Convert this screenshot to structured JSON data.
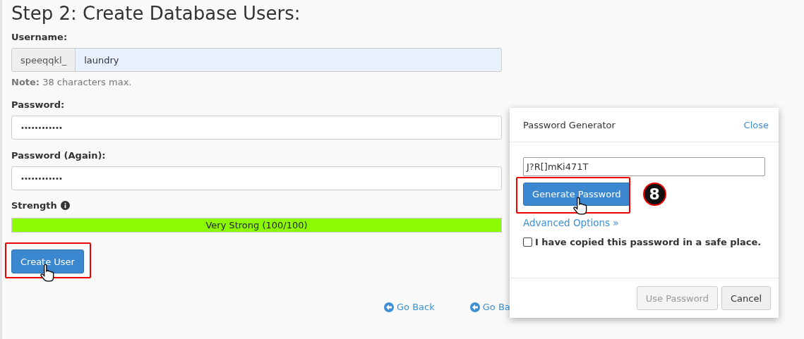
{
  "heading": "Step 2: Create Database Users:",
  "username": {
    "label": "Username:",
    "prefix": "speeqqkl_",
    "value": "laundry",
    "note_bold": "Note:",
    "note": "38 characters max."
  },
  "password": {
    "label": "Password:",
    "value": "••••••••••••"
  },
  "password_again": {
    "label": "Password (Again):",
    "value": "••••••••••••"
  },
  "strength": {
    "label": "Strength",
    "level": 1,
    "reading": "Very Strong (100/100)"
  },
  "create_button": {
    "label": "Create User",
    "highlighted": true
  },
  "links": [
    {
      "label": "Go Back"
    },
    {
      "label": "Go Ba"
    }
  ],
  "generator": {
    "title": "Password Generator",
    "close": "Close",
    "value": "J?R[]mKi471T",
    "generate": {
      "label": "Generate Password",
      "highlighted": true
    },
    "step": "8",
    "advanced": "Advanced Options »",
    "copied": {
      "label": "I have copied this password in a safe place.",
      "checked": false
    },
    "use_password": {
      "label": "Use Password",
      "disabled": true
    },
    "cancel": "Cancel"
  }
}
